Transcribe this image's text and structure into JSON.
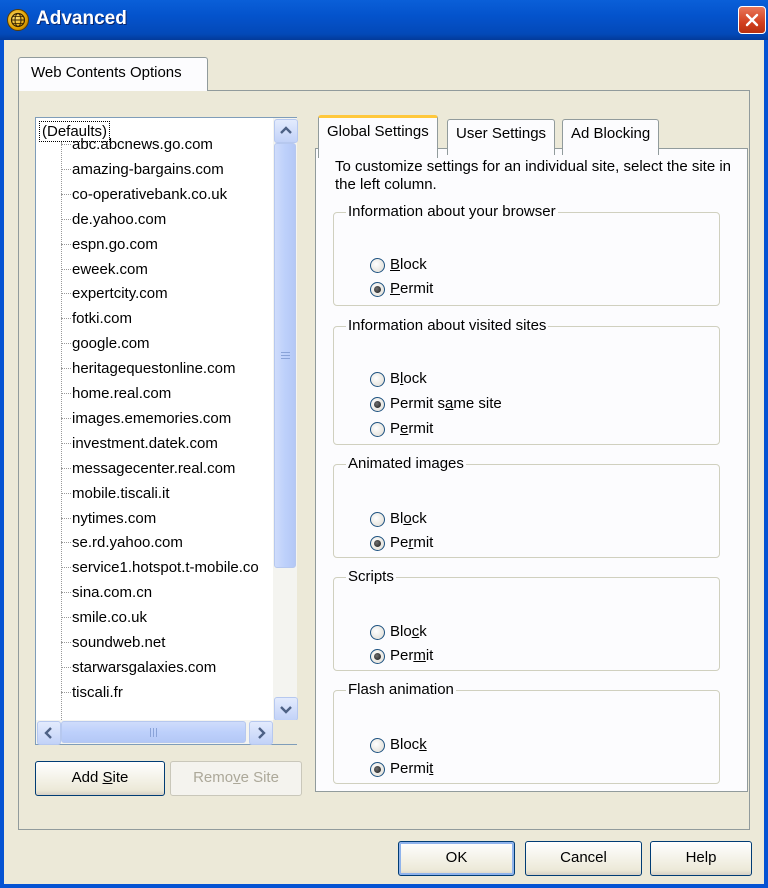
{
  "window": {
    "title": "Advanced",
    "close_label": "Close"
  },
  "outer_tab": {
    "label": "Web Contents Options"
  },
  "site_list": {
    "root": "(Defaults)",
    "items": [
      "abc.abcnews.go.com",
      "amazing-bargains.com",
      "co-operativebank.co.uk",
      "de.yahoo.com",
      "espn.go.com",
      "eweek.com",
      "expertcity.com",
      "fotki.com",
      "google.com",
      "heritagequestonline.com",
      "home.real.com",
      "images.ememories.com",
      "investment.datek.com",
      "messagecenter.real.com",
      "mobile.tiscali.it",
      "nytimes.com",
      "se.rd.yahoo.com",
      "service1.hotspot.t-mobile.co",
      "sina.com.cn",
      "smile.co.uk",
      "soundweb.net",
      "starwarsgalaxies.com",
      "tiscali.fr"
    ]
  },
  "buttons": {
    "add_site_pre": "Add ",
    "add_site_acc": "S",
    "add_site_post": "ite",
    "remove_site_pre": "Remo",
    "remove_site_acc": "v",
    "remove_site_post": "e Site",
    "ok": "OK",
    "cancel": "Cancel",
    "help": "Help"
  },
  "tabs": [
    {
      "label": "Global Settings",
      "active": true
    },
    {
      "label": "User Settings",
      "active": false
    },
    {
      "label": "Ad Blocking",
      "active": false
    }
  ],
  "global_settings": {
    "description": "To customize settings for an individual site, select the site in the left column.",
    "groups": [
      {
        "title": "Information about your browser",
        "options": [
          {
            "pre": "",
            "acc": "B",
            "post": "lock",
            "selected": false
          },
          {
            "pre": "",
            "acc": "P",
            "post": "ermit",
            "selected": true
          }
        ]
      },
      {
        "title": "Information about visited sites",
        "options": [
          {
            "pre": "B",
            "acc": "l",
            "post": "ock",
            "selected": false
          },
          {
            "pre": "Permit s",
            "acc": "a",
            "post": "me site",
            "selected": true
          },
          {
            "pre": "P",
            "acc": "e",
            "post": "rmit",
            "selected": false
          }
        ]
      },
      {
        "title": "Animated images",
        "options": [
          {
            "pre": "Bl",
            "acc": "o",
            "post": "ck",
            "selected": false
          },
          {
            "pre": "Pe",
            "acc": "r",
            "post": "mit",
            "selected": true
          }
        ]
      },
      {
        "title": "Scripts",
        "options": [
          {
            "pre": "Blo",
            "acc": "c",
            "post": "k",
            "selected": false
          },
          {
            "pre": "Per",
            "acc": "m",
            "post": "it",
            "selected": true
          }
        ]
      },
      {
        "title": "Flash animation",
        "options": [
          {
            "pre": "Bloc",
            "acc": "k",
            "post": "",
            "selected": false
          },
          {
            "pre": "Permi",
            "acc": "t",
            "post": "",
            "selected": true
          }
        ]
      }
    ]
  }
}
